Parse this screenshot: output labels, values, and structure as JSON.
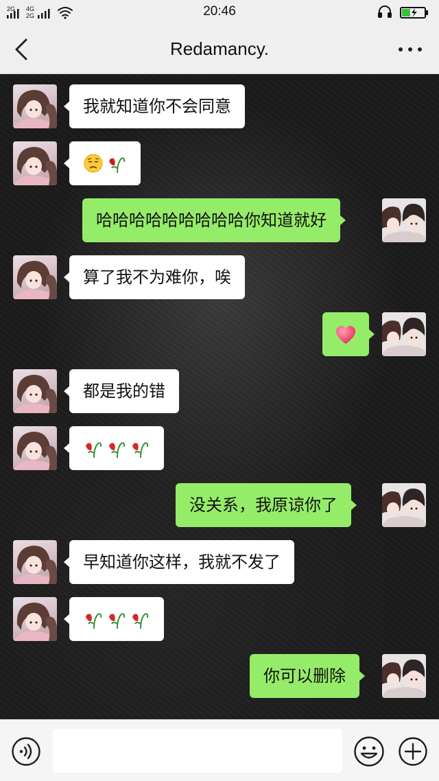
{
  "status_bar": {
    "time": "20:46",
    "signal_label_1": "2G",
    "signal_label_2": "4G",
    "signal_label_3": "2G",
    "icons": [
      "signal-icon",
      "wifi-icon",
      "headset-icon",
      "battery-icon"
    ]
  },
  "header": {
    "title": "Redamancy.",
    "back_icon": "chevron-left-icon",
    "more_icon": "more-dots-icon"
  },
  "messages": [
    {
      "side": "left",
      "text": "我就知道你不会同意"
    },
    {
      "side": "left",
      "emojis": [
        "pensive-face",
        "wilted-flower"
      ]
    },
    {
      "side": "right",
      "text": "哈哈哈哈哈哈哈哈哈你知道就好"
    },
    {
      "side": "left",
      "text": "算了我不为难你，唉"
    },
    {
      "side": "right",
      "emojis": [
        "heart"
      ]
    },
    {
      "side": "left",
      "text": "都是我的错"
    },
    {
      "side": "left",
      "emojis": [
        "wilted-flower",
        "wilted-flower",
        "wilted-flower"
      ]
    },
    {
      "side": "right",
      "text": "没关系，我原谅你了"
    },
    {
      "side": "left",
      "text": "早知道你这样，我就不发了"
    },
    {
      "side": "left",
      "emojis": [
        "wilted-flower",
        "wilted-flower",
        "wilted-flower"
      ]
    },
    {
      "side": "right",
      "text": "你可以删除"
    }
  ],
  "input_bar": {
    "value": "",
    "placeholder": "",
    "icons": [
      "voice-icon",
      "emoji-icon",
      "plus-icon"
    ]
  },
  "colors": {
    "sent_bubble": "#95ec69",
    "received_bubble": "#ffffff",
    "chat_background": "#1b1b1b",
    "bar_background": "#efefef"
  }
}
